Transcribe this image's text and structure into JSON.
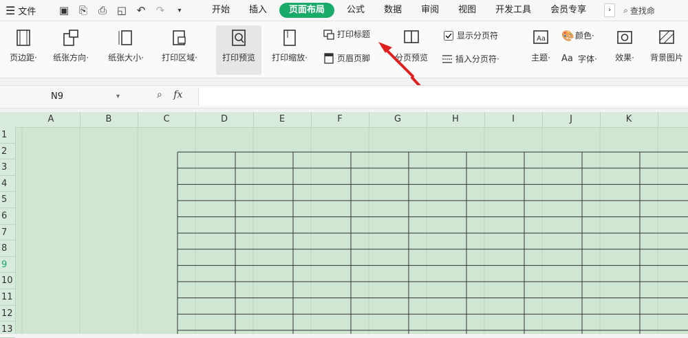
{
  "menubar": {
    "file_label": "文件",
    "tabs": [
      "开始",
      "插入",
      "页面布局",
      "公式",
      "数据",
      "审阅",
      "视图",
      "开发工具",
      "会员专享"
    ],
    "active_tab": "页面布局",
    "more": "›",
    "search_label": "查找命"
  },
  "ribbon": {
    "margins": "页边距·",
    "orientation": "纸张方向·",
    "size": "纸张大小·",
    "print_area": "打印区域·",
    "print_preview": "打印预览",
    "print_scale": "打印缩放·",
    "print_titles": "打印标题",
    "header_footer": "页眉页脚",
    "page_break_preview": "分页预览",
    "show_page_breaks": "显示分页符",
    "insert_page_break": "插入分页符·",
    "theme": "主题·",
    "colors": "颜色·",
    "fonts": "字体·",
    "effects": "效果·",
    "background": "背景图片"
  },
  "formula_bar": {
    "name_box": "N9",
    "fx": "fx"
  },
  "grid": {
    "columns": [
      "A",
      "B",
      "C",
      "D",
      "E",
      "F",
      "G",
      "H",
      "I",
      "J",
      "K"
    ],
    "rows": [
      "1",
      "2",
      "3",
      "4",
      "5",
      "6",
      "7",
      "8",
      "9",
      "10",
      "11",
      "12",
      "13"
    ],
    "selected_row": "9"
  },
  "colors": {
    "accent": "#1aaa6a",
    "sheet_bg": "#cfe7d2",
    "arrow": "#e02020"
  }
}
